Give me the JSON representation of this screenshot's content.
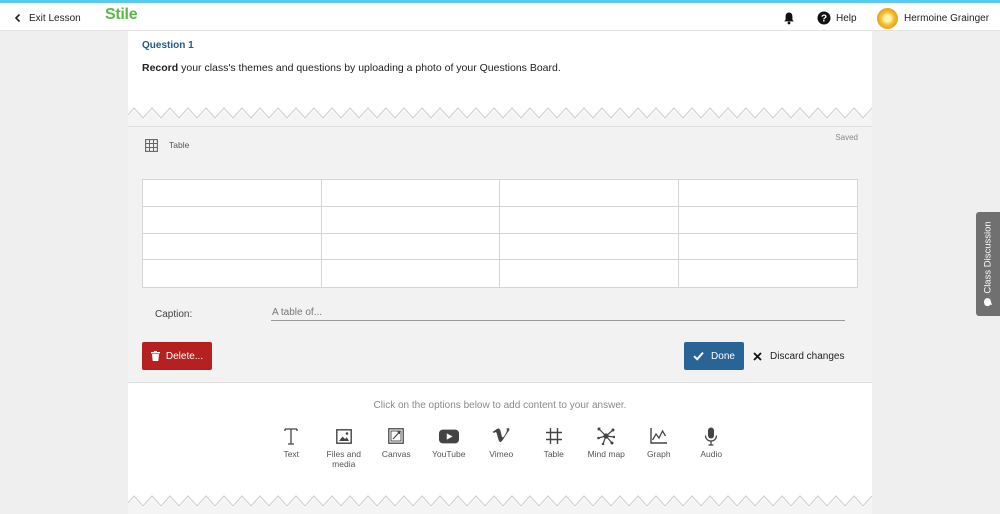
{
  "topbar": {
    "exit_label": "Exit Lesson",
    "logo_text": "Stile",
    "help_label": "Help",
    "user_name": "Hermoine Grainger"
  },
  "question": {
    "title": "Question 1",
    "text_bold": "Record",
    "text_rest": " your class's themes and questions by uploading a photo of your Questions Board."
  },
  "editor": {
    "block_label": "Table",
    "status": "Saved",
    "table": {
      "rows": 4,
      "columns": 4,
      "cells": [
        [
          "",
          "",
          "",
          ""
        ],
        [
          "",
          "",
          "",
          ""
        ],
        [
          "",
          "",
          "",
          ""
        ],
        [
          "",
          "",
          "",
          ""
        ]
      ]
    },
    "caption_label": "Caption:",
    "caption_placeholder": "A table of...",
    "caption_value": "",
    "delete_label": "Delete...",
    "done_label": "Done",
    "discard_label": "Discard changes"
  },
  "add_content": {
    "hint": "Click on the options below to add content to your answer.",
    "tools": [
      {
        "label": "Text",
        "icon": "text-icon"
      },
      {
        "label": "Files and media",
        "icon": "image-icon"
      },
      {
        "label": "Canvas",
        "icon": "canvas-icon"
      },
      {
        "label": "YouTube",
        "icon": "youtube-icon"
      },
      {
        "label": "Vimeo",
        "icon": "vimeo-icon"
      },
      {
        "label": "Table",
        "icon": "table-icon"
      },
      {
        "label": "Mind map",
        "icon": "mind-map-icon"
      },
      {
        "label": "Graph",
        "icon": "graph-icon"
      },
      {
        "label": "Audio",
        "icon": "microphone-icon"
      }
    ]
  },
  "side_tab": {
    "label": "Class Discussion"
  },
  "colors": {
    "accent_top": "#5bc8f0",
    "logo_green": "#5ab945",
    "question_title": "#1e5a91",
    "delete_red": "#b52020",
    "done_blue": "#2a6496"
  }
}
